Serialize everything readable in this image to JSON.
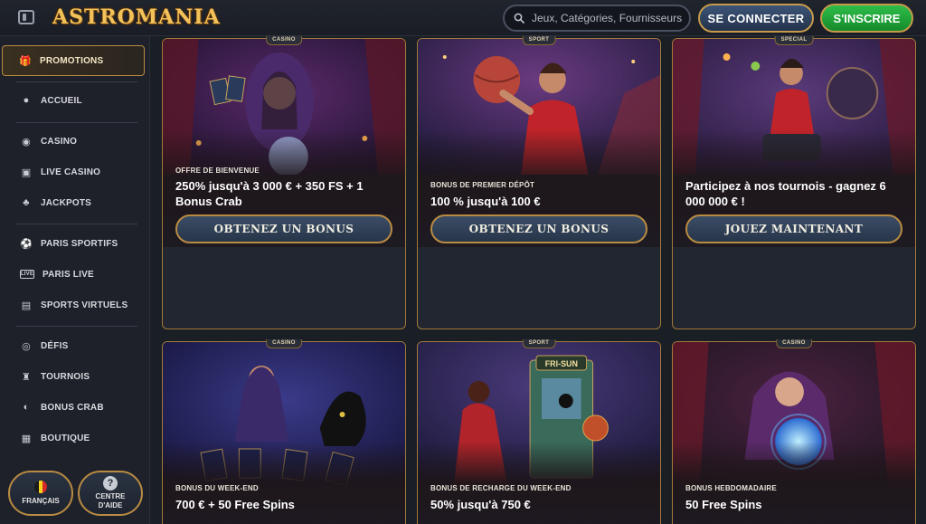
{
  "header": {
    "logo_text": "ASTROMANIA",
    "search_placeholder": "Jeux, Catégories, Fournisseurs",
    "login_label": "SE CONNECTER",
    "signup_label": "S'INSCRIRE"
  },
  "sidebar": {
    "items": [
      {
        "label": "PROMOTIONS",
        "icon": "gift-icon"
      },
      {
        "label": "ACCUEIL",
        "icon": "home-icon"
      },
      {
        "label": "CASINO",
        "icon": "casino-chip-icon"
      },
      {
        "label": "LIVE CASINO",
        "icon": "live-cards-icon"
      },
      {
        "label": "JACKPOTS",
        "icon": "clover-icon"
      },
      {
        "label": "PARIS SPORTIFS",
        "icon": "soccer-ball-icon"
      },
      {
        "label": "PARIS LIVE",
        "icon": "live-badge-icon"
      },
      {
        "label": "SPORTS VIRTUELS",
        "icon": "virtual-sports-icon"
      },
      {
        "label": "DÉFIS",
        "icon": "challenge-icon"
      },
      {
        "label": "TOURNOIS",
        "icon": "trophy-icon"
      },
      {
        "label": "BONUS CRAB",
        "icon": "crab-icon"
      },
      {
        "label": "BOUTIQUE",
        "icon": "shop-icon"
      }
    ],
    "language_label": "FRANÇAIS",
    "help_label_line1": "CENTRE",
    "help_label_line2": "D'AIDE"
  },
  "cards": [
    {
      "tag": "CASINO",
      "subtitle": "OFFRE DE BIENVENUE",
      "title": "250% jusqu'à 3 000 € + 350 FS + 1 Bonus Crab",
      "cta": "OBTENEZ UN BONUS"
    },
    {
      "tag": "SPORT",
      "subtitle": "BONUS DE PREMIER DÉPÔT",
      "title": "100 % jusqu'à 100 €",
      "cta": "OBTENEZ UN BONUS"
    },
    {
      "tag": "SPECIAL",
      "subtitle": "",
      "title": "Participez à nos tournois - gagnez 6 000 000 € !",
      "cta": "JOUEZ MAINTENANT"
    },
    {
      "tag": "CASINO",
      "subtitle": "BONUS DU WEEK-END",
      "title": "700 € + 50 Free Spins",
      "cta": ""
    },
    {
      "tag": "SPORT",
      "subtitle": "BONUS DE RECHARGE DU WEEK-END",
      "title": "50% jusqu'à 750 €",
      "cta": ""
    },
    {
      "tag": "CASINO",
      "subtitle": "BONUS HEBDOMADAIRE",
      "title": "50 Free Spins",
      "cta": ""
    }
  ],
  "arcade_sign": "FRI-SUN",
  "colors": {
    "accent_gold": "#b98b42",
    "signup_green": "#22a83a",
    "login_blue": "#2f4462"
  }
}
